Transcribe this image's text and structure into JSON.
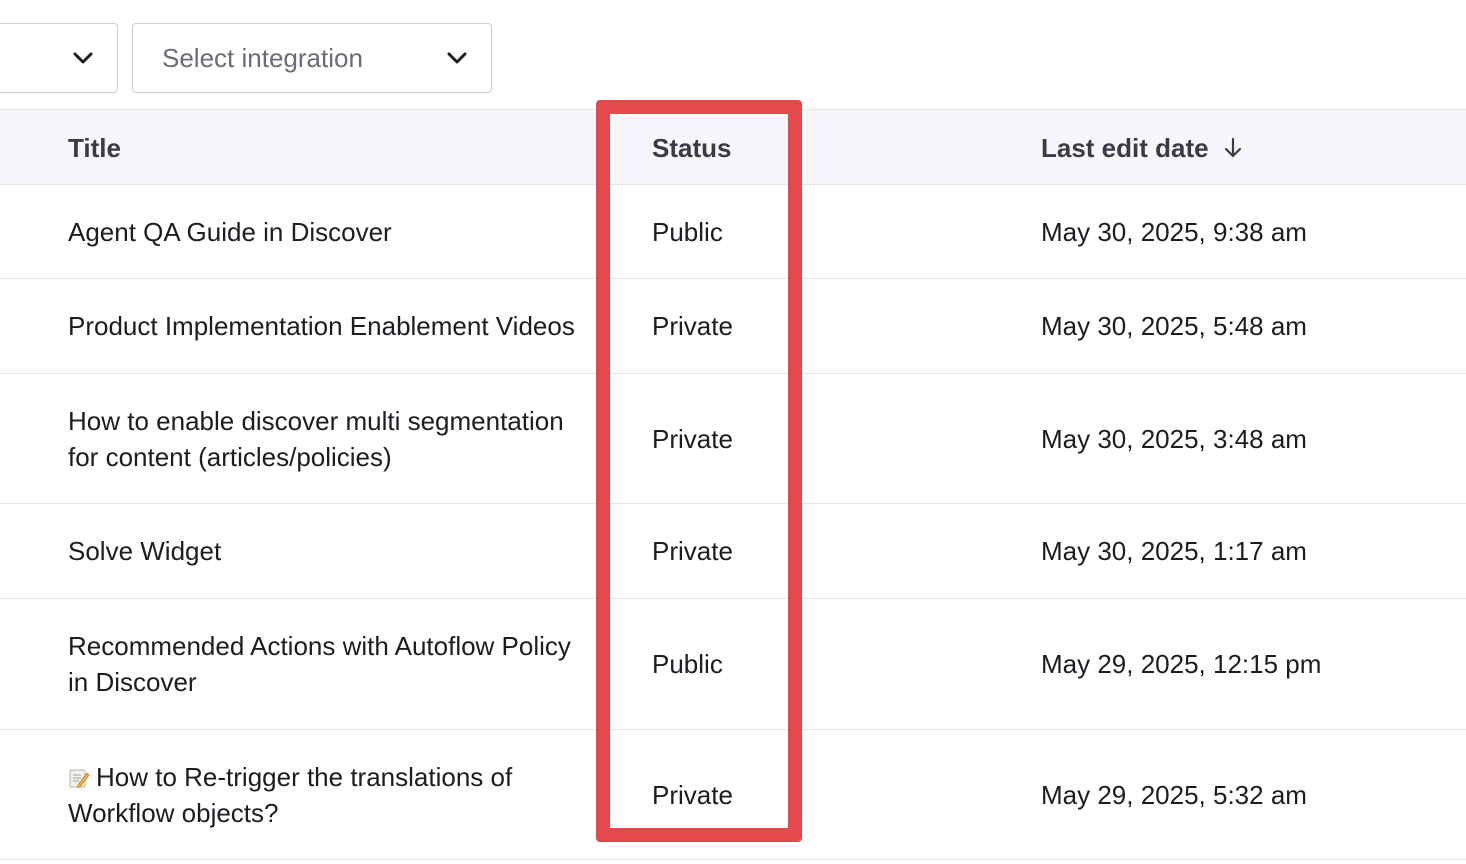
{
  "filters": {
    "first_dropdown_value": "",
    "integration_placeholder": "Select integration"
  },
  "table": {
    "columns": {
      "title": "Title",
      "status": "Status",
      "last_edit_date": "Last edit date"
    },
    "sort": {
      "column": "last_edit_date",
      "direction": "descending",
      "icon": "arrow-down-icon"
    },
    "rows": [
      {
        "title": "Agent QA Guide in Discover",
        "status": "Public",
        "date": "May 30, 2025, 9:38 am"
      },
      {
        "title": "Product Implementation Enablement Videos",
        "status": "Private",
        "date": "May 30, 2025, 5:48 am"
      },
      {
        "title": "How to enable discover multi segmentation for content (articles/policies)",
        "status": "Private",
        "date": "May 30, 2025, 3:48 am"
      },
      {
        "title": "Solve Widget",
        "status": "Private",
        "date": "May 30, 2025, 1:17 am"
      },
      {
        "title": "Recommended Actions with Autoflow Policy in Discover",
        "status": "Public",
        "date": "May 29, 2025, 12:15 pm"
      },
      {
        "title": "How to Re-trigger the translations of Workflow objects?",
        "title_icon": "memo-icon",
        "status": "Private",
        "date": "May 29, 2025, 5:32 am"
      }
    ]
  },
  "highlight": {
    "color": "#e5484d",
    "target": "status-column"
  }
}
